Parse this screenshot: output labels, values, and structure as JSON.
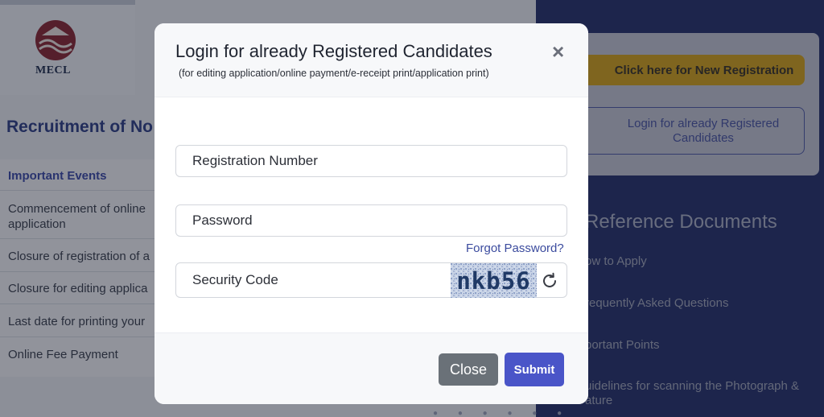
{
  "background": {
    "logo_text": "MECL",
    "recruitment_title": "Recruitment of No",
    "events_heading": "Important Events",
    "events": [
      "Commencement of online application",
      "Closure of registration of a",
      "Closure for editing applica",
      "Last date for printing your",
      "Online Fee Payment"
    ],
    "new_registration_label": "Click here for New Registration",
    "login_registered_label": "Login for already Registered Candidates",
    "reference_title": "Reference Documents",
    "reference_items": [
      "ow to Apply",
      "requently Asked Questions",
      "portant Points",
      "uidelines for scanning the Photograph &",
      "ature"
    ]
  },
  "modal": {
    "title": "Login for already Registered Candidates",
    "subtitle": "(for editing application/online payment/e-receipt print/application print)",
    "close_icon": "close-icon",
    "fields": {
      "registration_placeholder": "Registration Number",
      "registration_value": "",
      "password_placeholder": "Password",
      "password_value": "",
      "security_placeholder": "Security Code",
      "security_value": ""
    },
    "forgot_password": "Forgot Password?",
    "captcha_text": "nkb56",
    "refresh_icon": "refresh-icon",
    "close_button": "Close",
    "submit_button": "Submit"
  },
  "colors": {
    "primary": "#4a55c8",
    "secondary": "#6a7178",
    "link": "#3b4b9e",
    "accent_yellow": "#d7a519",
    "navy": "#25306a"
  }
}
